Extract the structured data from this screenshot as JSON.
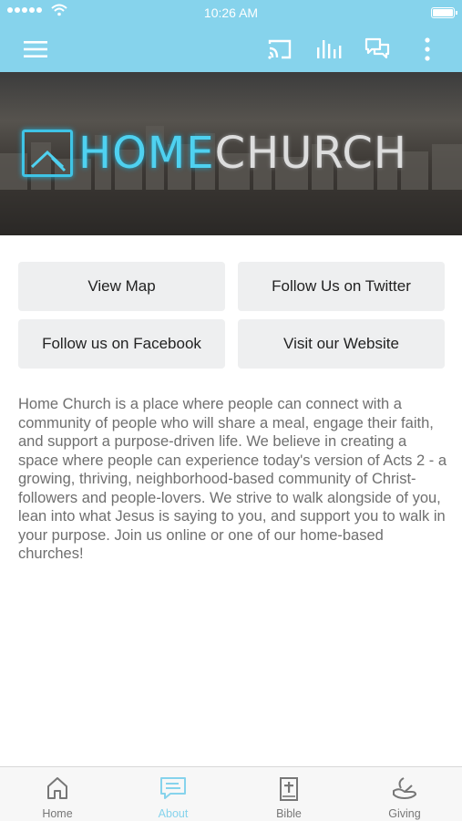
{
  "status": {
    "time": "10:26 AM"
  },
  "appbar": {
    "icons": [
      "menu-icon",
      "cast-icon",
      "audio-bars-icon",
      "chat-icon",
      "more-vertical-icon"
    ]
  },
  "banner": {
    "logo_home": "HOME",
    "logo_church": "CHURCH"
  },
  "actions": {
    "view_map": "View Map",
    "twitter": "Follow Us on Twitter",
    "facebook": "Follow us on Facebook",
    "website": "Visit our Website"
  },
  "about": {
    "text": "Home Church is a place where people can connect with a community of people who will share a meal, engage their faith, and support a purpose-driven life. We believe in creating a space where people can experience today's version of Acts 2 - a growing, thriving, neighborhood-based community of Christ-followers and people-lovers. We strive to walk alongside of you, lean into what Jesus is saying to you, and support you to walk in your purpose. Join us online or one of our home-based churches!"
  },
  "tabs": [
    {
      "label": "Home",
      "icon": "home-icon"
    },
    {
      "label": "About",
      "icon": "about-icon",
      "active": true
    },
    {
      "label": "Bible",
      "icon": "bible-icon"
    },
    {
      "label": "Giving",
      "icon": "giving-icon"
    }
  ],
  "colors": {
    "accent": "#86d3ec",
    "button_bg": "#eeeff0",
    "body_text": "#6f6f6f",
    "tab_inactive": "#777777"
  }
}
